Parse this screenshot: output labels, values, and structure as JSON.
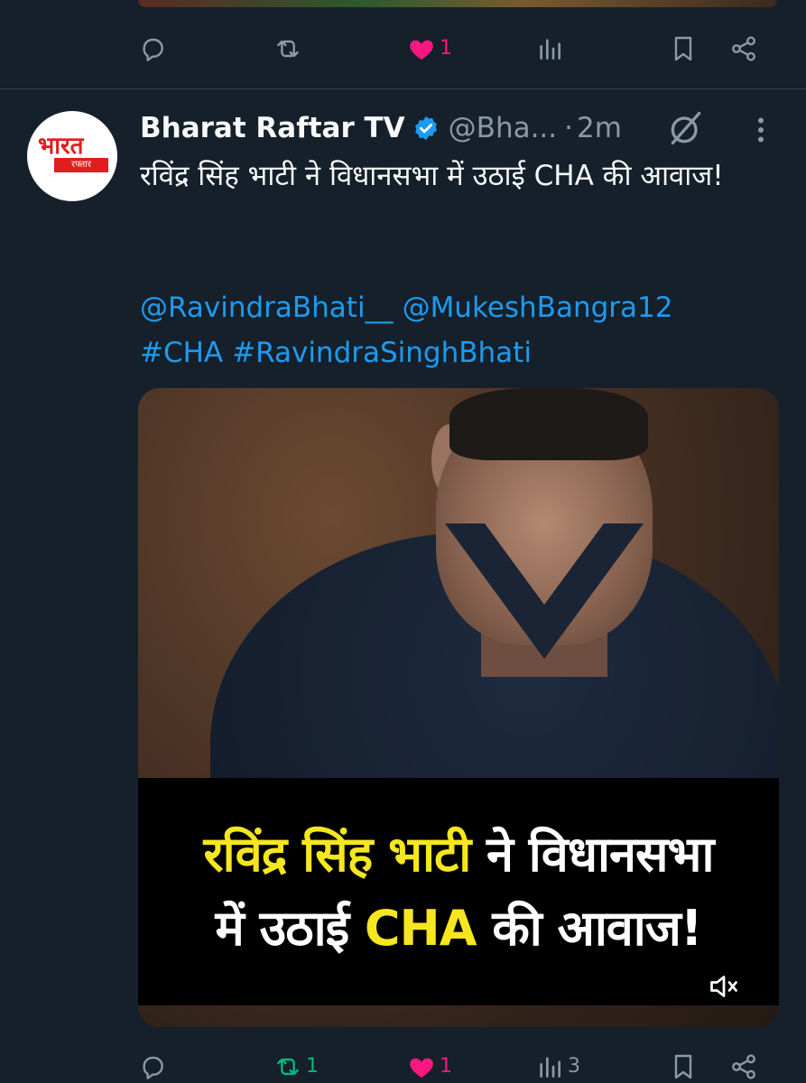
{
  "previous_tweet": {
    "actions": {
      "reply": {
        "count": ""
      },
      "repost": {
        "count": ""
      },
      "like": {
        "count": "1"
      },
      "views": {
        "count": ""
      }
    }
  },
  "tweet": {
    "author": {
      "display_name": "Bharat Raftar TV",
      "handle": "@Bha...",
      "verified": true,
      "avatar_text_top": "भारत",
      "avatar_text_bottom": "रफ्तार"
    },
    "separator": "·",
    "time": "2m",
    "text": "रविंद्र सिंह भाटी ने विधानसभा में उठाई CHA की आवाज!",
    "mentions": [
      "@RavindraBhati__",
      "@MukeshBangra12"
    ],
    "hashtags": [
      "#CHA",
      "#RavindraSinghBhati"
    ],
    "media": {
      "caption_line1_yellow": "रविंद्र सिंह भाटी",
      "caption_line1_white": " ने विधानसभा",
      "caption_line2_white_a": "में उठाई ",
      "caption_line2_yellow": "CHA",
      "caption_line2_white_b": " की आवाज!",
      "muted": true
    },
    "actions": {
      "reply": {
        "count": ""
      },
      "repost": {
        "count": "1"
      },
      "like": {
        "count": "1"
      },
      "views": {
        "count": "3"
      }
    }
  },
  "colors": {
    "background": "#15202b",
    "accent": "#1d9bf0",
    "like": "#f91880",
    "repost": "#00ba7c",
    "muted_text": "#8b98a5"
  }
}
